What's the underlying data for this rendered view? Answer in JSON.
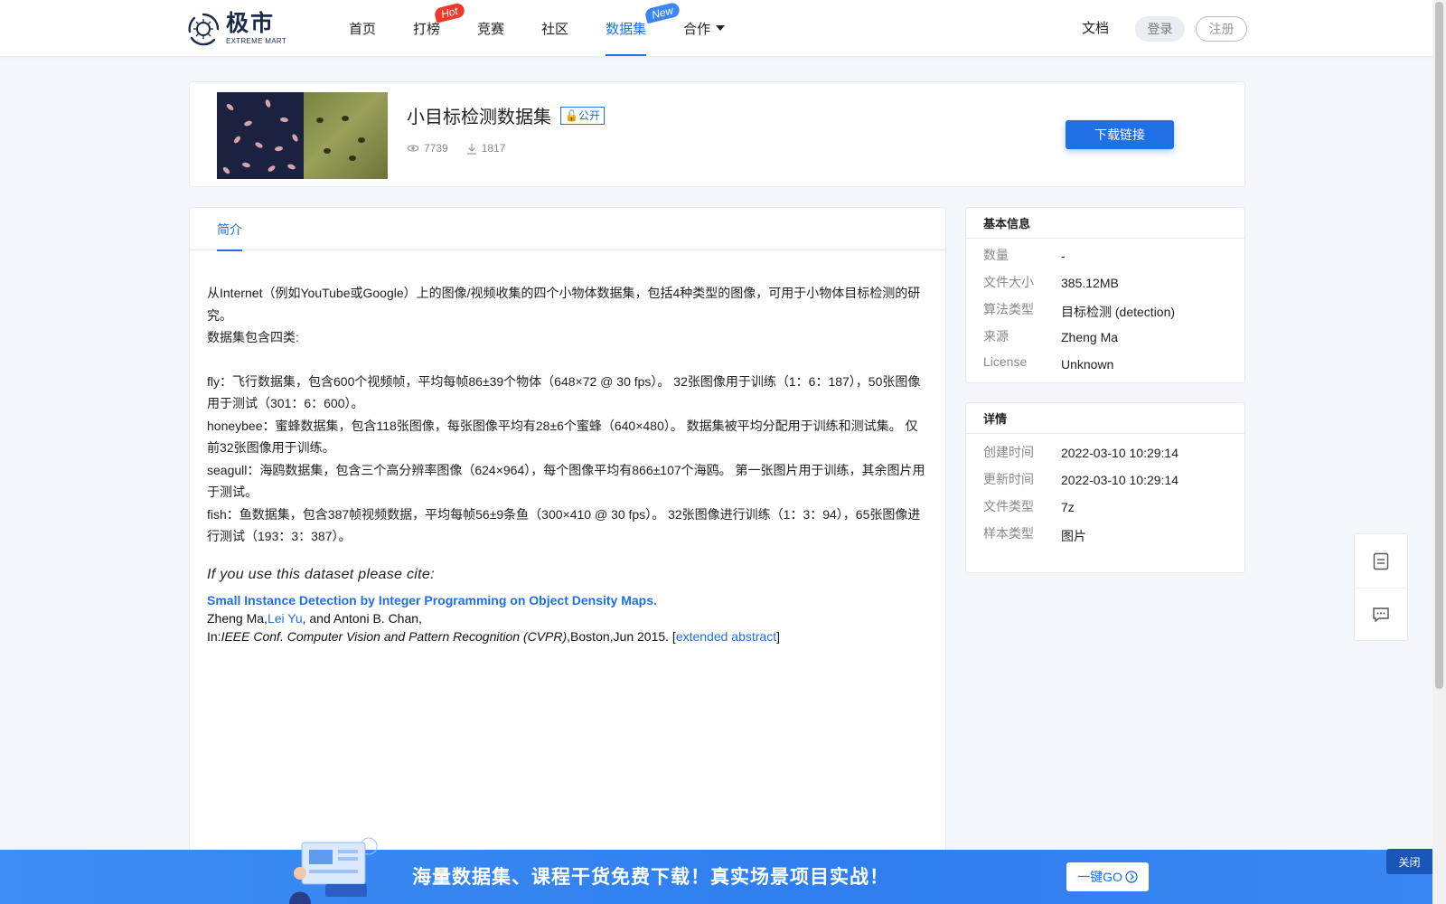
{
  "brand": {
    "name_cn": "极市",
    "name_en": "EXTREME MART"
  },
  "nav": {
    "items": [
      {
        "label": "首页"
      },
      {
        "label": "打榜",
        "badge": "Hot"
      },
      {
        "label": "竞赛"
      },
      {
        "label": "社区"
      },
      {
        "label": "数据集",
        "badge": "New",
        "active": true
      },
      {
        "label": "合作",
        "dropdown": true
      }
    ],
    "docs_label": "文档",
    "login_label": "登录",
    "register_label": "注册"
  },
  "dataset": {
    "title": "小目标检测数据集",
    "visibility": "公开",
    "views": "7739",
    "downloads": "1817",
    "download_button": "下载链接"
  },
  "tabs": {
    "intro": "简介"
  },
  "intro": {
    "p1": "从Internet（例如YouTube或Google）上的图像/视频收集的四个小物体数据集，包括4种类型的图像，可用于小物体目标检测的研究。",
    "p2": "数据集包含四类:",
    "fly": "fly：飞行数据集，包含600个视频帧，平均每帧86±39个物体（648×72 @ 30 fps）。 32张图像用于训练（1：6：187），50张图像用于测试（301：6：600）。",
    "honeybee": "honeybee：蜜蜂数据集，包含118张图像，每张图像平均有28±6个蜜蜂（640×480）。 数据集被平均分配用于训练和测试集。 仅前32张图像用于训练。",
    "seagull": "seagull：海鸥数据集，包含三个高分辨率图像（624×964），每个图像平均有866±107个海鸥。 第一张图片用于训练，其余图片用于测试。",
    "fish": "fish：鱼数据集，包含387帧视频数据，平均每帧56±9条鱼（300×410 @ 30 fps）。 32张图像进行训练（1：3：94），65张图像进行测试（193：3：387）。",
    "cite_heading": "If you use this dataset please cite:",
    "cite_title": "Small Instance Detection by Integer Programming on Object Density Maps.",
    "author_1": "Zheng Ma,",
    "author_2": "Lei Yu",
    "author_3": ", and Antoni B. Chan,",
    "venue_prefix": "In:",
    "venue": "IEEE Conf. Computer Vision and Pattern Recognition (CVPR)",
    "venue_suffix": ",Boston,Jun 2015. [",
    "abstract_link": "extended abstract",
    "venue_close": "]"
  },
  "basic_info": {
    "heading": "基本信息",
    "rows": [
      {
        "key": "数量",
        "value": "-"
      },
      {
        "key": "文件大小",
        "value": "385.12MB"
      },
      {
        "key": "算法类型",
        "value": "目标检测 (detection)"
      },
      {
        "key": "来源",
        "value": "Zheng Ma"
      },
      {
        "key": "License",
        "value": "Unknown"
      }
    ]
  },
  "details": {
    "heading": "详情",
    "rows": [
      {
        "key": "创建时间",
        "value": "2022-03-10 10:29:14"
      },
      {
        "key": "更新时间",
        "value": "2022-03-10 10:29:14"
      },
      {
        "key": "文件类型",
        "value": "7z"
      },
      {
        "key": "样本类型",
        "value": "图片"
      }
    ]
  },
  "banner": {
    "text": "海量数据集、课程干货免费下载！真实场景项目实战！",
    "go_label": "一键GO",
    "close_label": "关闭"
  },
  "icons": {
    "views": "eye-icon",
    "downloads": "download-icon",
    "public": "lock-open-icon",
    "tool_1": "notes-icon",
    "tool_2": "chat-icon",
    "go": "arrow-circle-right-icon"
  },
  "colors": {
    "accent": "#1f6fe5",
    "hot": "#f0392b",
    "new": "#3b86f3",
    "banner": "#2f7ef0"
  }
}
